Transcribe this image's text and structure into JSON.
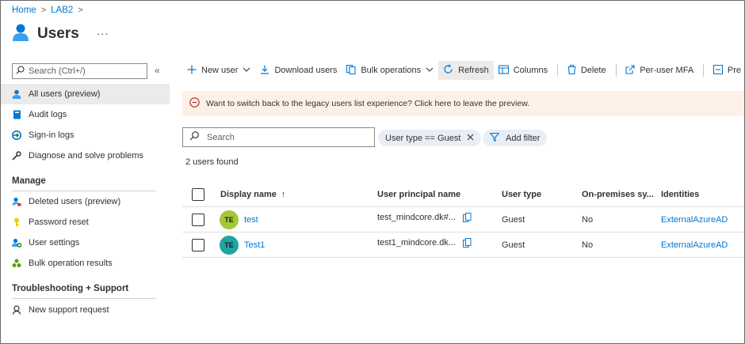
{
  "breadcrumb": {
    "home": "Home",
    "lab": "LAB2",
    "sep1": ">",
    "sep2": ">"
  },
  "page": {
    "title": "Users",
    "more": "···"
  },
  "sidebar": {
    "search_placeholder": "Search (Ctrl+/)",
    "collapse": "«",
    "items": [
      {
        "label": "All users (preview)"
      },
      {
        "label": "Audit logs"
      },
      {
        "label": "Sign-in logs"
      },
      {
        "label": "Diagnose and solve problems"
      }
    ],
    "manage_heading": "Manage",
    "manage_items": [
      {
        "label": "Deleted users (preview)"
      },
      {
        "label": "Password reset"
      },
      {
        "label": "User settings"
      },
      {
        "label": "Bulk operation results"
      }
    ],
    "support_heading": "Troubleshooting + Support",
    "support_items": [
      {
        "label": "New support request"
      }
    ]
  },
  "toolbar": {
    "new_user": "New user",
    "download_users": "Download users",
    "bulk_operations": "Bulk operations",
    "refresh": "Refresh",
    "columns": "Columns",
    "delete": "Delete",
    "per_user_mfa": "Per-user MFA",
    "preview": "Pre"
  },
  "banner": {
    "text": "Want to switch back to the legacy users list experience? Click here to leave the preview."
  },
  "filters": {
    "search_placeholder": "Search",
    "user_type_filter": "User type == Guest",
    "add_filter": "Add filter"
  },
  "results": {
    "count_text": "2 users found"
  },
  "table": {
    "columns": [
      "Display name",
      "User principal name",
      "User type",
      "On-premises sy...",
      "Identities"
    ],
    "sort_indicator": "↑",
    "rows": [
      {
        "initials": "TE",
        "avatar_color": "#a4c639",
        "name": "test",
        "upn": "test_mindcore.dk#...",
        "user_type": "Guest",
        "on_prem": "No",
        "identities": "ExternalAzureAD"
      },
      {
        "initials": "TE",
        "avatar_color": "#1fa6a0",
        "name": "Test1",
        "upn": "test1_mindcore.dk...",
        "user_type": "Guest",
        "on_prem": "No",
        "identities": "ExternalAzureAD"
      }
    ]
  },
  "colors": {
    "accent": "#0078d4",
    "banner_bg": "#fdf1e7",
    "selected_bg": "#edebe9"
  }
}
